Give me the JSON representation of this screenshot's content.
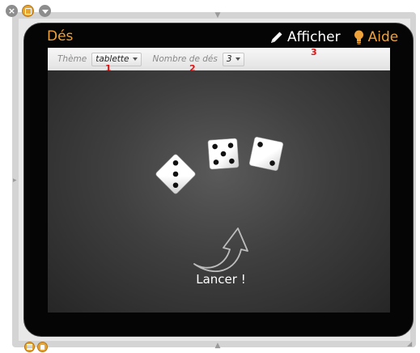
{
  "app": {
    "title": "Dés",
    "show_label": "Afficher",
    "help_label": "Aide"
  },
  "toolbar": {
    "theme_label": "Thème",
    "theme_value": "tablette",
    "dice_count_label": "Nombre de dés",
    "dice_count_value": "3"
  },
  "markers": {
    "m1": "1",
    "m2": "2",
    "m3": "3"
  },
  "dice": [
    {
      "value": 3,
      "rotation_deg": 45
    },
    {
      "value": 5,
      "rotation_deg": -4
    },
    {
      "value": 2,
      "rotation_deg": 12
    }
  ],
  "action": {
    "roll_label": "Lancer !"
  },
  "colors": {
    "accent": "#f0a23a",
    "marker": "#e21313",
    "tablet": "#050505",
    "stage": "#3f3f3f"
  },
  "icons": {
    "show": "pencil-icon",
    "help": "lightbulb-icon",
    "roll": "curved-arrow-icon",
    "close": "close-icon",
    "duplicate": "duplicate-icon",
    "minimize": "minimize-icon"
  }
}
